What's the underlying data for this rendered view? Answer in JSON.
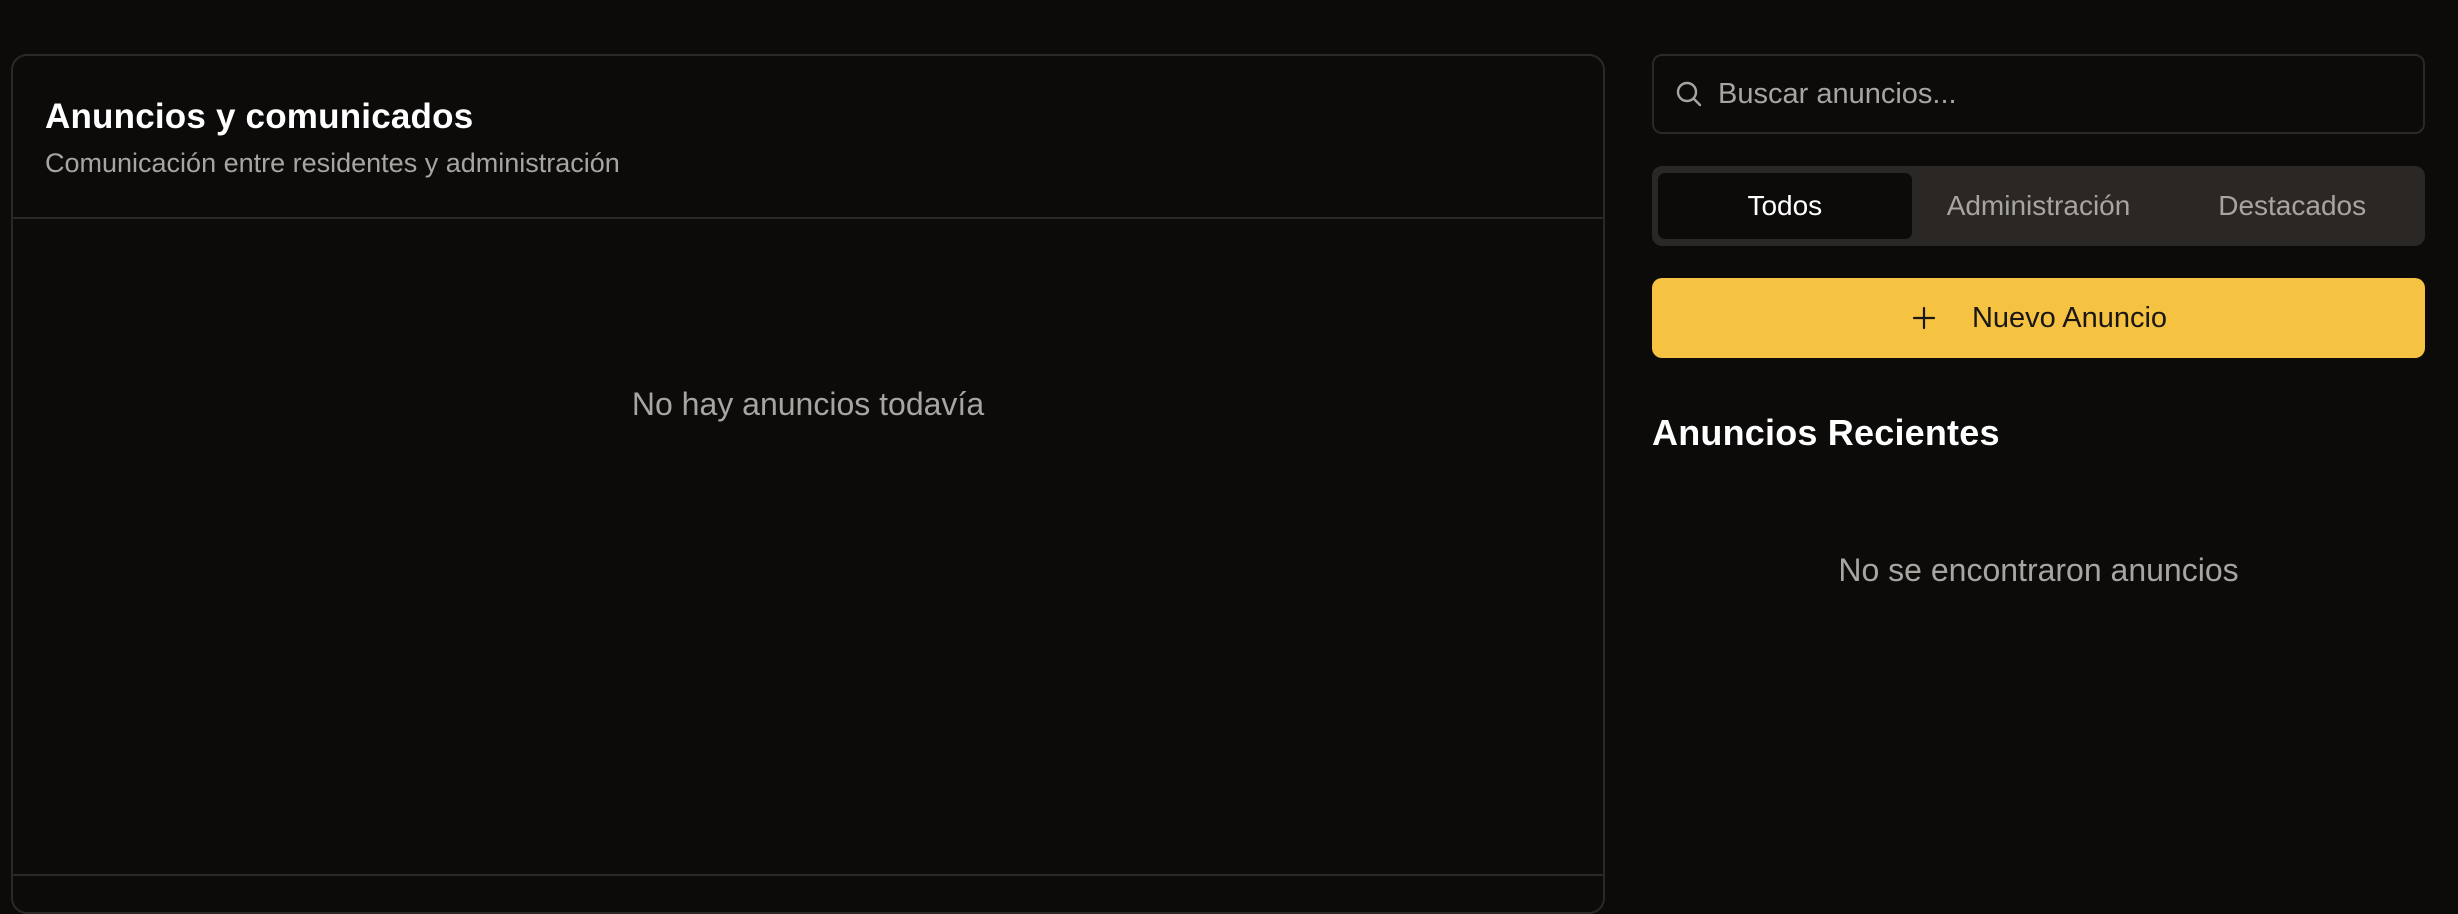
{
  "main": {
    "title": "Anuncios y comunicados",
    "subtitle": "Comunicación entre residentes y administración",
    "empty_text": "No hay anuncios todavía"
  },
  "sidebar": {
    "search": {
      "placeholder": "Buscar anuncios...",
      "value": "",
      "icon": "search-icon"
    },
    "tabs": [
      {
        "label": "Todos",
        "active": true
      },
      {
        "label": "Administración",
        "active": false
      },
      {
        "label": "Destacados",
        "active": false
      }
    ],
    "new_button": {
      "label": "Nuevo Anuncio",
      "icon": "plus-icon"
    },
    "recent": {
      "title": "Anuncios Recientes",
      "empty_text": "No se encontraron anuncios"
    }
  },
  "colors": {
    "background": "#0c0b0a",
    "border": "#2b2927",
    "muted_text": "#a8a4a0",
    "accent": "#f5c242",
    "tab_bar": "#2a2725"
  }
}
